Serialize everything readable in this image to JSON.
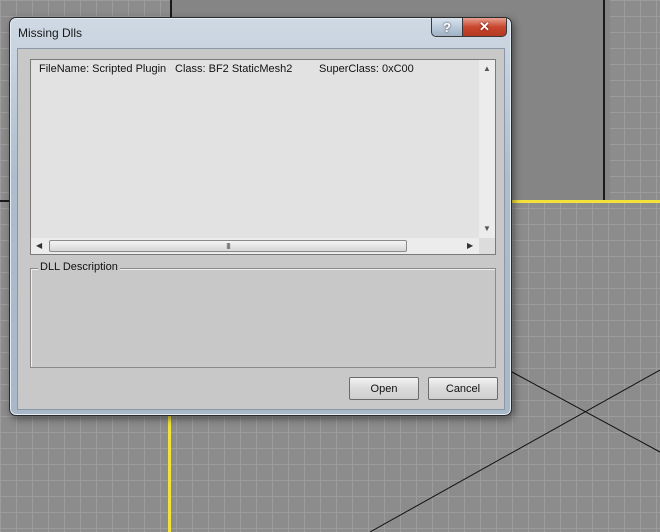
{
  "window": {
    "title": "Missing Dlls",
    "help_glyph": "?",
    "close_glyph": "✕"
  },
  "list": {
    "rows": [
      {
        "filename": "FileName:  Scripted Plugin",
        "class": "Class:  BF2 StaticMesh2",
        "superclass": "SuperClass: 0xC00"
      }
    ],
    "scroll_up_glyph": "▲",
    "scroll_down_glyph": "▼",
    "scroll_left_glyph": "◀",
    "scroll_right_glyph": "▶",
    "thumb_grip": "III"
  },
  "description": {
    "label": "DLL Description",
    "text": ""
  },
  "buttons": {
    "open": "Open",
    "cancel": "Cancel"
  },
  "colors": {
    "close_button": "#c8462e",
    "viewport_highlight": "#f3e23a"
  }
}
